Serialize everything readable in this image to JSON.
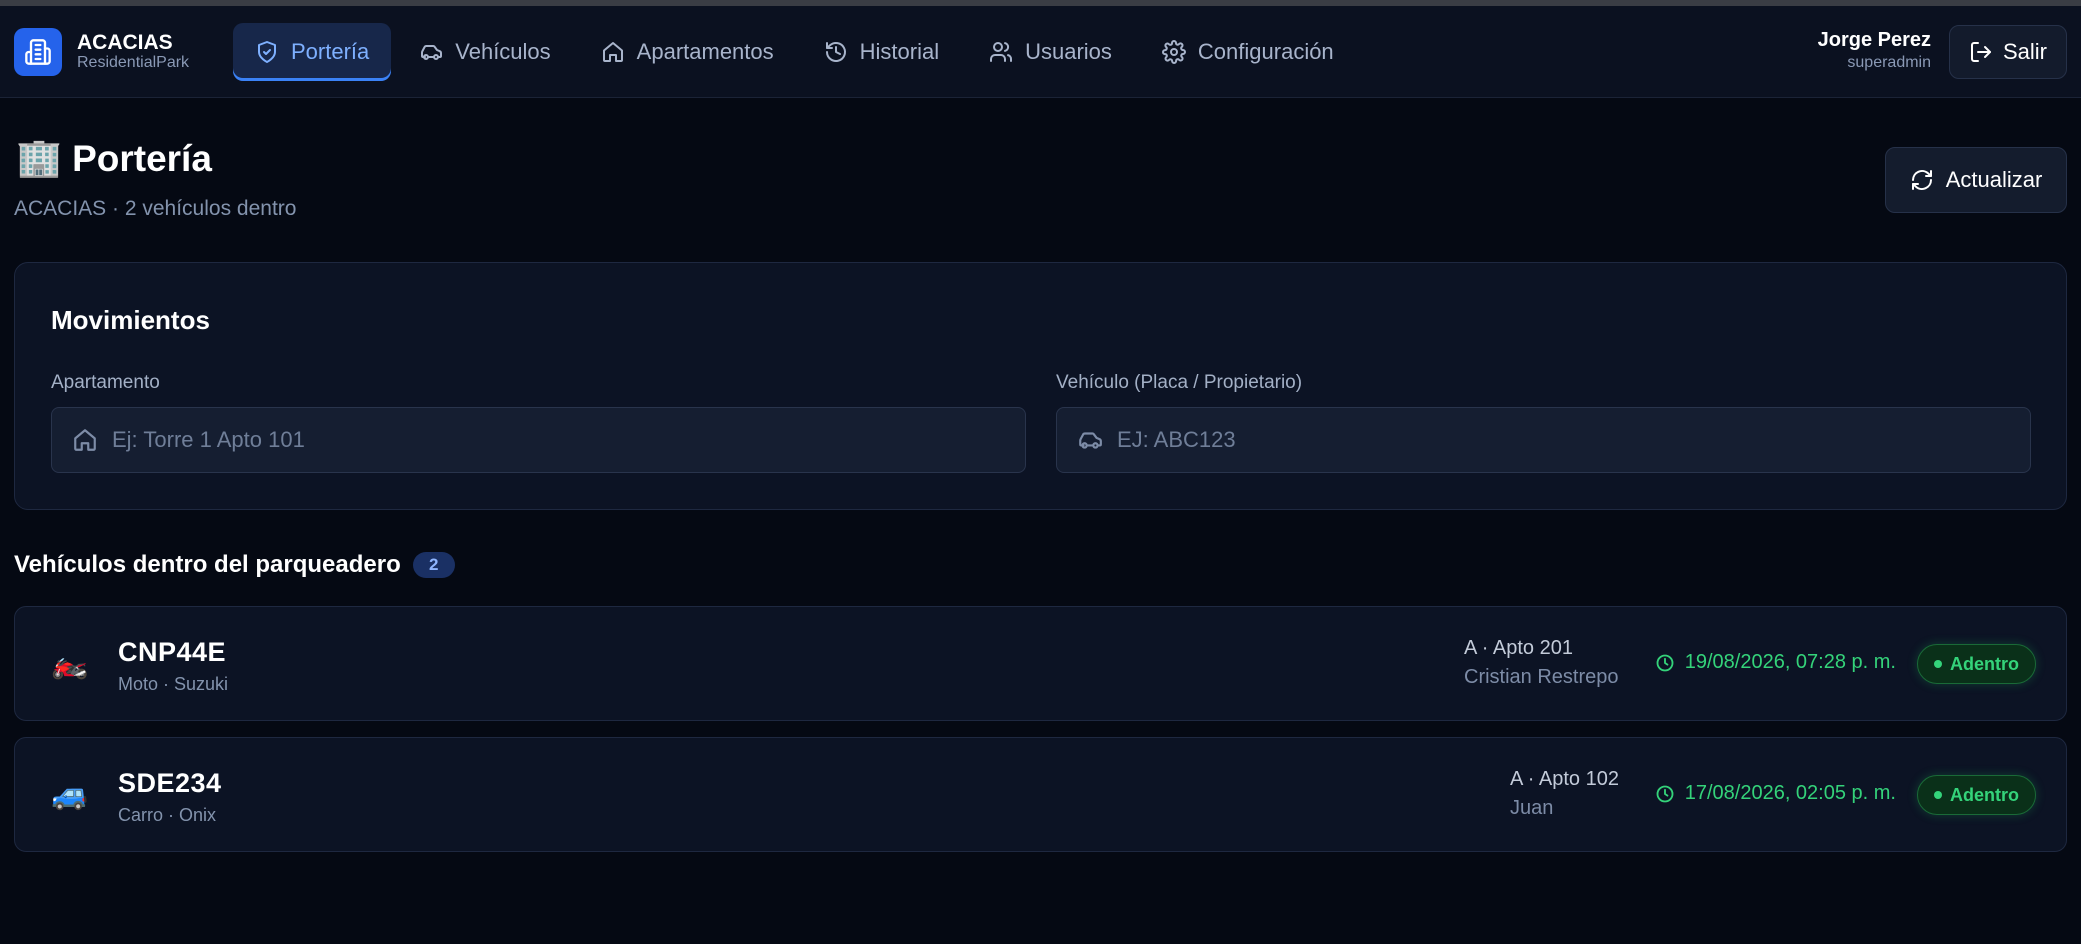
{
  "brand": {
    "name": "ACACIAS",
    "subtitle": "ResidentialPark"
  },
  "nav": [
    {
      "label": "Portería",
      "icon": "shield-icon",
      "active": true
    },
    {
      "label": "Vehículos",
      "icon": "car-icon"
    },
    {
      "label": "Apartamentos",
      "icon": "home-icon"
    },
    {
      "label": "Historial",
      "icon": "history-icon"
    },
    {
      "label": "Usuarios",
      "icon": "users-icon"
    },
    {
      "label": "Configuración",
      "icon": "gear-icon"
    }
  ],
  "user": {
    "name": "Jorge Perez",
    "role": "superadmin"
  },
  "logout_label": "Salir",
  "page": {
    "emoji": "🏢",
    "title": "Portería",
    "subtitle": "ACACIAS · 2 vehículos dentro",
    "refresh_label": "Actualizar"
  },
  "movimientos": {
    "title": "Movimientos",
    "apartment_label": "Apartamento",
    "apartment_placeholder": "Ej: Torre 1 Apto 101",
    "vehicle_label": "Vehículo (Placa / Propietario)",
    "vehicle_placeholder": "EJ: ABC123"
  },
  "inside": {
    "title": "Vehículos dentro del parqueadero",
    "count": "2",
    "vehicles": [
      {
        "icon": "🏍️",
        "plate": "CNP44E",
        "type": "Moto · Suzuki",
        "apartment": "A · Apto 201",
        "owner": "Cristian Restrepo",
        "time": "19/08/2026, 07:28 p. m.",
        "status": "Adentro"
      },
      {
        "icon": "🚙",
        "plate": "SDE234",
        "type": "Carro · Onix",
        "apartment": "A · Apto 102",
        "owner": "Juan",
        "time": "17/08/2026, 02:05 p. m.",
        "status": "Adentro"
      }
    ]
  },
  "colors": {
    "accent": "#2563eb",
    "active_nav_text": "#7eb0ff",
    "status_green": "#34d37a",
    "background": "#050913",
    "card": "#0c1324"
  }
}
